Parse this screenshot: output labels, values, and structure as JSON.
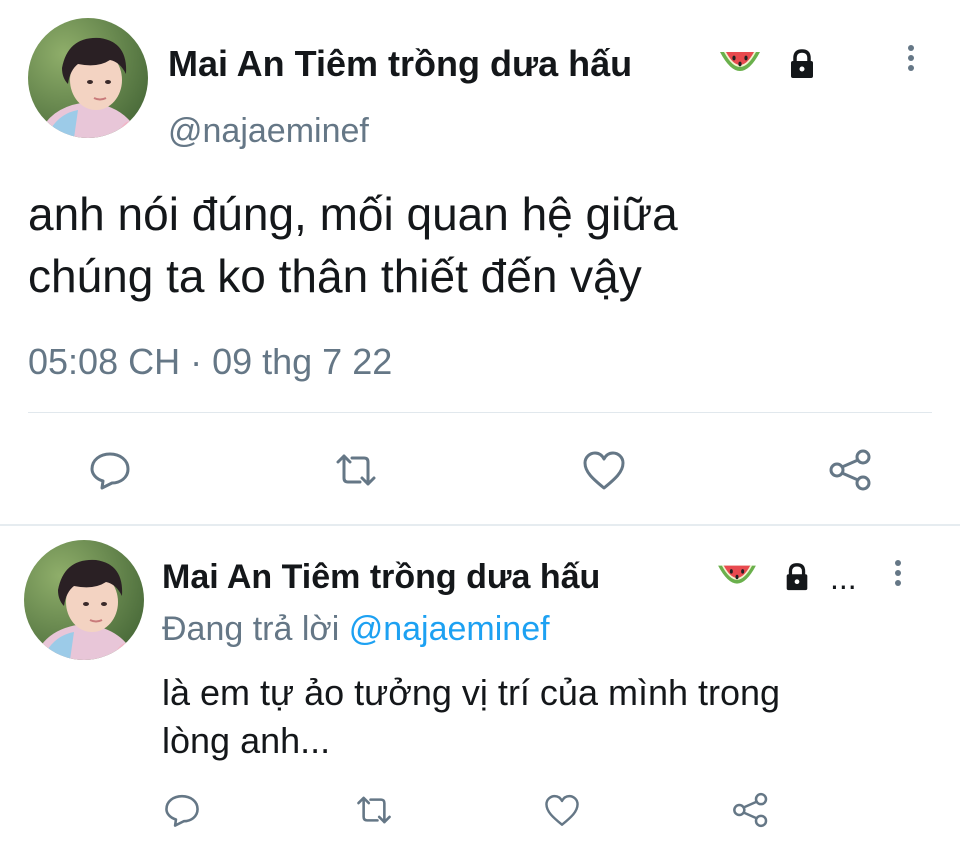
{
  "main_tweet": {
    "display_name": "Mai An Tiêm trồng dưa hấu",
    "handle": "@najaeminef",
    "text_line1": "anh nói đúng, mối quan hệ giữa",
    "text_line2": "chúng ta ko thân thiết đến vậy",
    "timestamp": "05:08 CH · 09 thg 7 22"
  },
  "reply_tweet": {
    "display_name": "Mai An Tiêm trồng dưa hấu",
    "ellipsis": "...",
    "replying_prefix": "Đang trả lời",
    "replying_to": "@najaeminef",
    "text_line1": "là em tự ảo tưởng vị trí của mình trong",
    "text_line2": "lòng anh..."
  },
  "icons": {
    "watermelon": "watermelon-emoji",
    "lock": "lock-icon",
    "more": "more-vertical-icon",
    "reply": "reply-icon",
    "retweet": "retweet-icon",
    "like": "heart-icon",
    "share": "share-icon"
  },
  "colors": {
    "text_primary": "#14171a",
    "text_secondary": "#657786",
    "link": "#1da1f2",
    "divider": "#e1e8ed"
  }
}
